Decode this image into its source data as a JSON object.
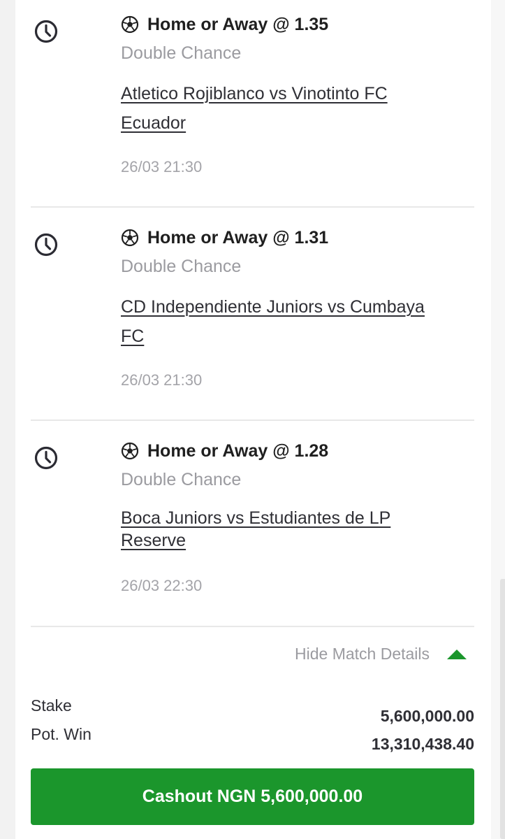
{
  "bets": [
    {
      "pick": "Home or Away @ 1.35",
      "market": "Double Chance",
      "match_line1": "Atletico Rojiblanco vs Vinotinto FC",
      "match_line2": "Ecuador",
      "kickoff": "26/03 21:30"
    },
    {
      "pick": "Home or Away @ 1.31",
      "market": "Double Chance",
      "match_line1": "CD Independiente Juniors vs Cumbaya",
      "match_line2": "FC",
      "kickoff": "26/03 21:30"
    },
    {
      "pick": "Home or Away @ 1.28",
      "market": "Double Chance",
      "match_line1": "Boca Juniors vs Estudiantes de LP",
      "match_line2": "Reserve",
      "kickoff": "26/03 22:30"
    }
  ],
  "details_toggle": {
    "label": "Hide Match Details",
    "icon": "triangle-up-icon"
  },
  "summary": {
    "stake_label": "Stake",
    "stake_value": "5,600,000.00",
    "pot_win_label": "Pot. Win",
    "pot_win_value": "13,310,438.40"
  },
  "cashout": {
    "label": "Cashout NGN 5,600,000.00"
  },
  "icons": {
    "status": "clock-icon",
    "sport": "soccer-ball-icon"
  },
  "colors": {
    "accent_green": "#1b962c",
    "muted_text": "#9b9ba0",
    "separator": "#e8e8e8"
  }
}
